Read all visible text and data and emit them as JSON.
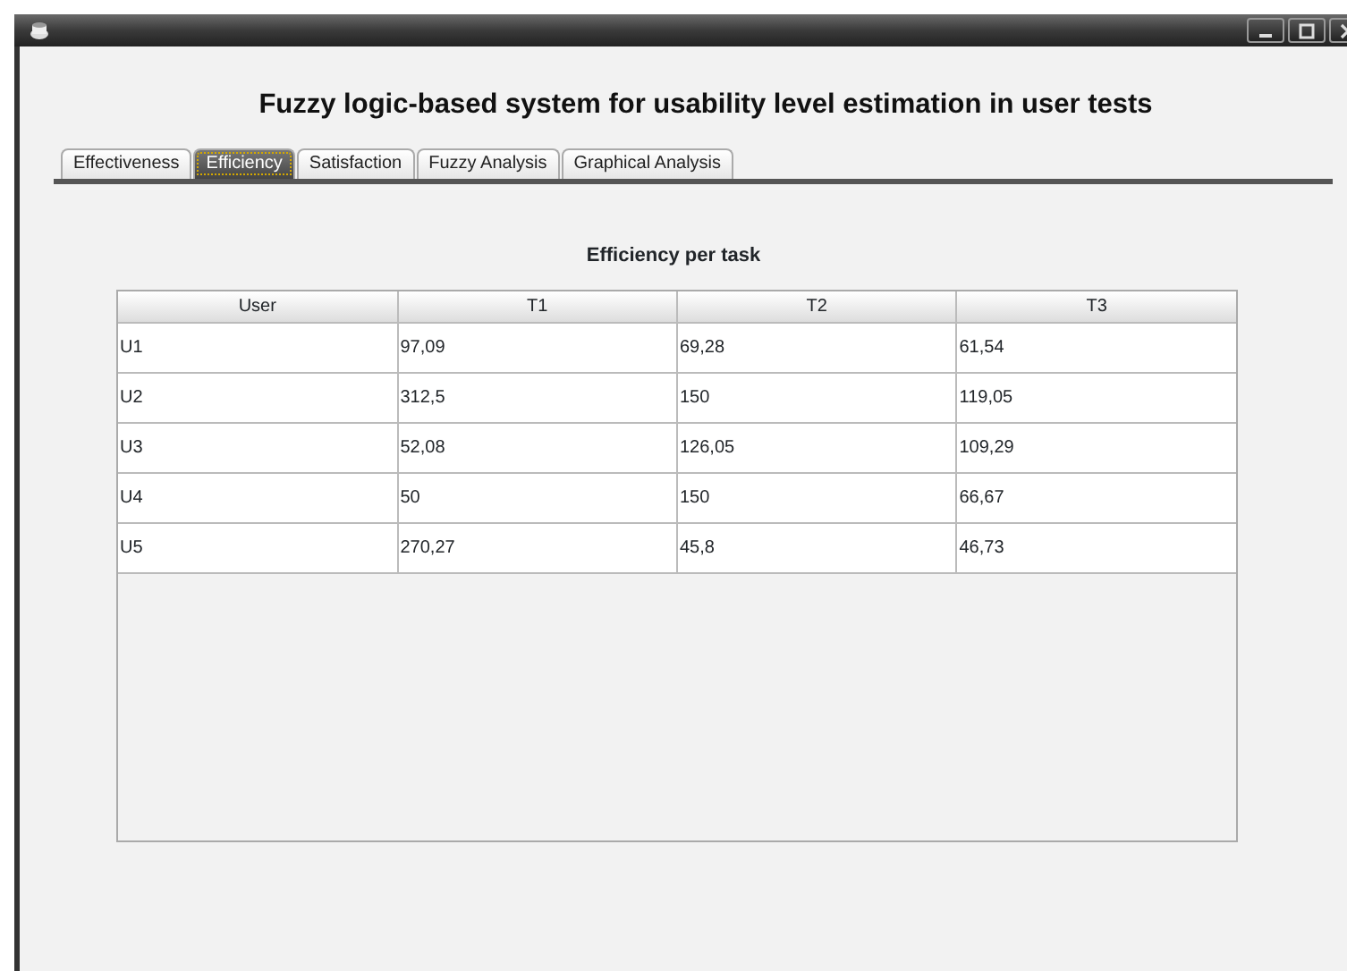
{
  "heading": "Fuzzy logic-based system for usability level estimation in user tests",
  "tabs": [
    {
      "label": "Effectiveness",
      "selected": false
    },
    {
      "label": "Efficiency",
      "selected": true
    },
    {
      "label": "Satisfaction",
      "selected": false
    },
    {
      "label": "Fuzzy Analysis",
      "selected": false
    },
    {
      "label": "Graphical Analysis",
      "selected": false
    }
  ],
  "table_title": "Efficiency per task",
  "table": {
    "columns": [
      "User",
      "T1",
      "T2",
      "T3"
    ],
    "rows": [
      [
        "U1",
        "97,09",
        "69,28",
        "61,54"
      ],
      [
        "U2",
        "312,5",
        "150",
        "119,05"
      ],
      [
        "U3",
        "52,08",
        "126,05",
        "109,29"
      ],
      [
        "U4",
        "50",
        "150",
        "66,67"
      ],
      [
        "U5",
        "270,27",
        "45,8",
        "46,73"
      ]
    ]
  }
}
